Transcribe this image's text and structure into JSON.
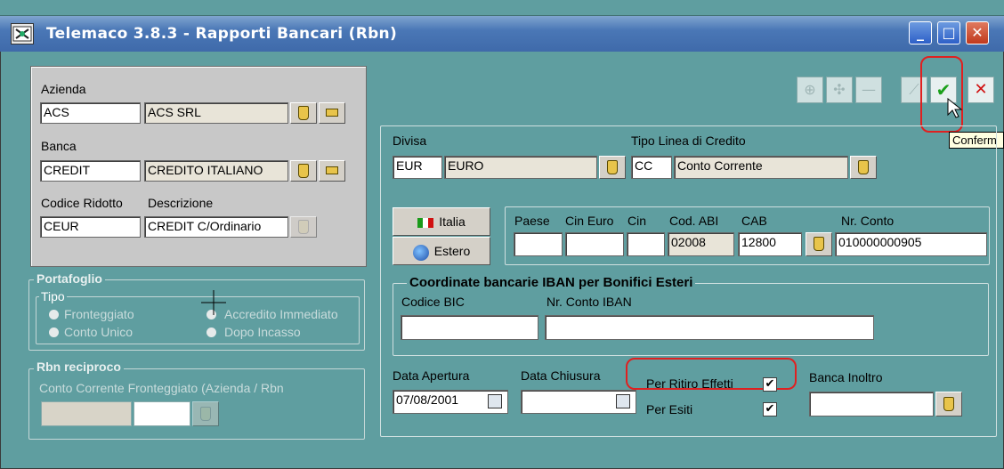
{
  "window": {
    "title": "Telemaco 3.8.3  - Rapporti Bancari (Rbn)",
    "min_label": "_",
    "max_label": "□",
    "close_label": "✕"
  },
  "header": {
    "azienda_label": "Azienda",
    "azienda_code": "ACS",
    "azienda_name": "ACS SRL",
    "banca_label": "Banca",
    "banca_code": "CREDIT",
    "banca_name": "CREDITO ITALIANO",
    "codice_label": "Codice Ridotto",
    "descrizione_label": "Descrizione",
    "codice_value": "CEUR",
    "descrizione_value": "CREDIT C/Ordinario"
  },
  "portafoglio": {
    "title": "Portafoglio",
    "tipo_label": "Tipo",
    "options": [
      "Fronteggiato",
      "Accredito Immediato",
      "Conto Unico",
      "Dopo Incasso"
    ]
  },
  "rbn_reciproco": {
    "title": "Rbn reciproco",
    "label": "Conto Corrente Fronteggiato (Azienda / Rbn"
  },
  "toolbar": {
    "confirm_glyph": "✔",
    "cancel_glyph": "✕",
    "tooltip": "Conferm"
  },
  "detail": {
    "divisa_label": "Divisa",
    "divisa_code": "EUR",
    "divisa_name": "EURO",
    "tipo_linea_label": "Tipo Linea di Credito",
    "tipo_linea_code": "CC",
    "tipo_linea_name": "Conto Corrente",
    "italia_label": "Italia",
    "estero_label": "Estero",
    "paese_label": "Paese",
    "cin_euro_label": "Cin Euro",
    "cin_label": "Cin",
    "abi_label": "Cod. ABI",
    "cab_label": "CAB",
    "nr_conto_label": "Nr. Conto",
    "abi_value": "02008",
    "cab_value": "12800",
    "nr_conto_value": "010000000905",
    "iban_title": "Coordinate bancarie IBAN per Bonifici Esteri",
    "bic_label": "Codice BIC",
    "iban_label": "Nr. Conto IBAN",
    "data_apertura_label": "Data Apertura",
    "data_apertura_value": "07/08/2001",
    "data_chiusura_label": "Data Chiusura",
    "ritiro_label": "Per Ritiro Effetti",
    "esiti_label": "Per Esiti",
    "banca_inoltro_label": "Banca Inoltro",
    "check_glyph": "✔"
  },
  "colors": {
    "window_bg": "#5f9ea0",
    "titlebar": "#4a77b6",
    "confirm_green": "#1aa01a",
    "cancel_red": "#d01010",
    "highlight_red": "#e02020"
  }
}
